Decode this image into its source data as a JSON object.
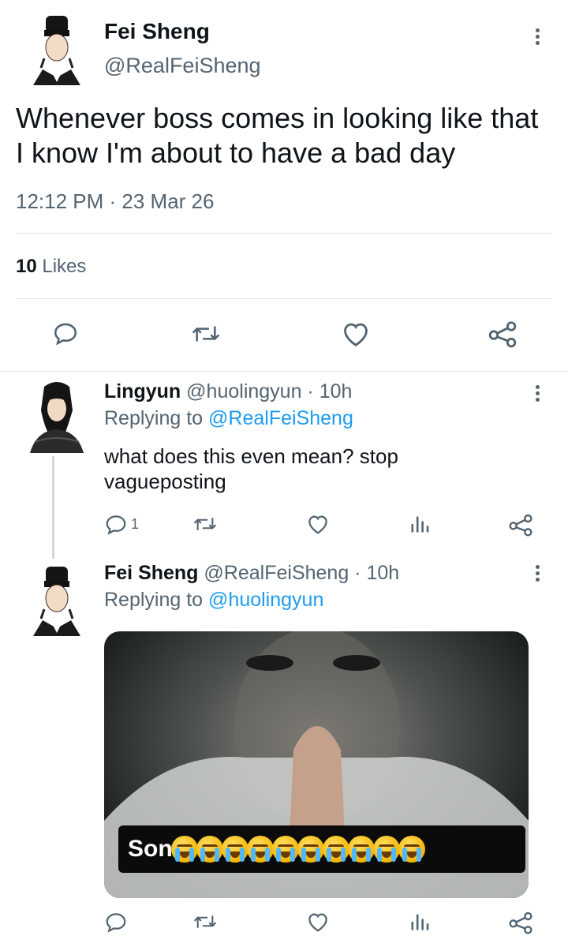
{
  "main_tweet": {
    "author_name": "Fei Sheng",
    "handle": "@RealFeiSheng",
    "text_line1": "Whenever boss comes in looking like that",
    "text_line2": "I know I'm about to have a bad day",
    "timestamp": "12:12 PM · 23 Mar 26",
    "likes_count": "10",
    "likes_label": "Likes"
  },
  "reply1": {
    "author_name": "Lingyun",
    "handle_time": "@huolingyun · 10h",
    "replying_prefix": "Replying to",
    "replying_to": "@RealFeiSheng",
    "text_line1": "what does this even mean? stop",
    "text_line2": "vagueposting",
    "reply_count": "1"
  },
  "reply2": {
    "author_name": "Fei Sheng",
    "handle_time": "@RealFeiSheng · 10h",
    "replying_prefix": "Replying to",
    "replying_to": "@huolingyun",
    "media_caption": "Son",
    "media_emoji_count": 10
  },
  "icons": [
    "reply-icon",
    "retweet-icon",
    "like-icon",
    "share-icon",
    "views-icon",
    "more-icon"
  ],
  "colors": {
    "text": "#0f1419",
    "muted": "#536471",
    "link": "#1d9bf0",
    "divider": "#e1e6ea"
  }
}
